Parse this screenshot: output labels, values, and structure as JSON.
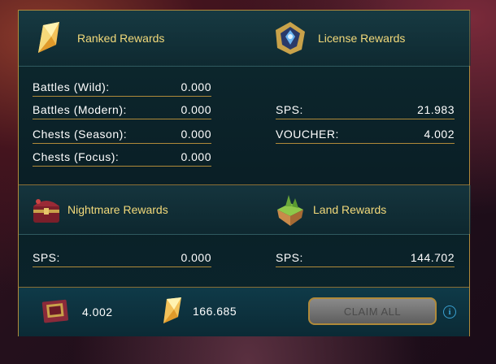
{
  "ranked": {
    "title": "Ranked Rewards",
    "rows": [
      {
        "label": "Battles (Wild):",
        "value": "0.000"
      },
      {
        "label": "Battles (Modern):",
        "value": "0.000"
      },
      {
        "label": "Chests (Season):",
        "value": "0.000"
      },
      {
        "label": "Chests (Focus):",
        "value": "0.000"
      }
    ]
  },
  "license": {
    "title": "License Rewards",
    "rows": [
      {
        "label": "SPS:",
        "value": "21.983"
      },
      {
        "label": "VOUCHER:",
        "value": "4.002"
      }
    ]
  },
  "nightmare": {
    "title": "Nightmare Rewards",
    "rows": [
      {
        "label": "SPS:",
        "value": "0.000"
      }
    ]
  },
  "land": {
    "title": "Land Rewards",
    "rows": [
      {
        "label": "SPS:",
        "value": "144.702"
      }
    ]
  },
  "footer": {
    "voucher_total": "4.002",
    "sps_total": "166.685",
    "claim_label": "CLAIM ALL",
    "info_glyph": "i"
  },
  "colors": {
    "gold": "#f2d97a",
    "border": "#b08a3a",
    "panel": "#0e2a30",
    "info": "#3aa0d0"
  }
}
